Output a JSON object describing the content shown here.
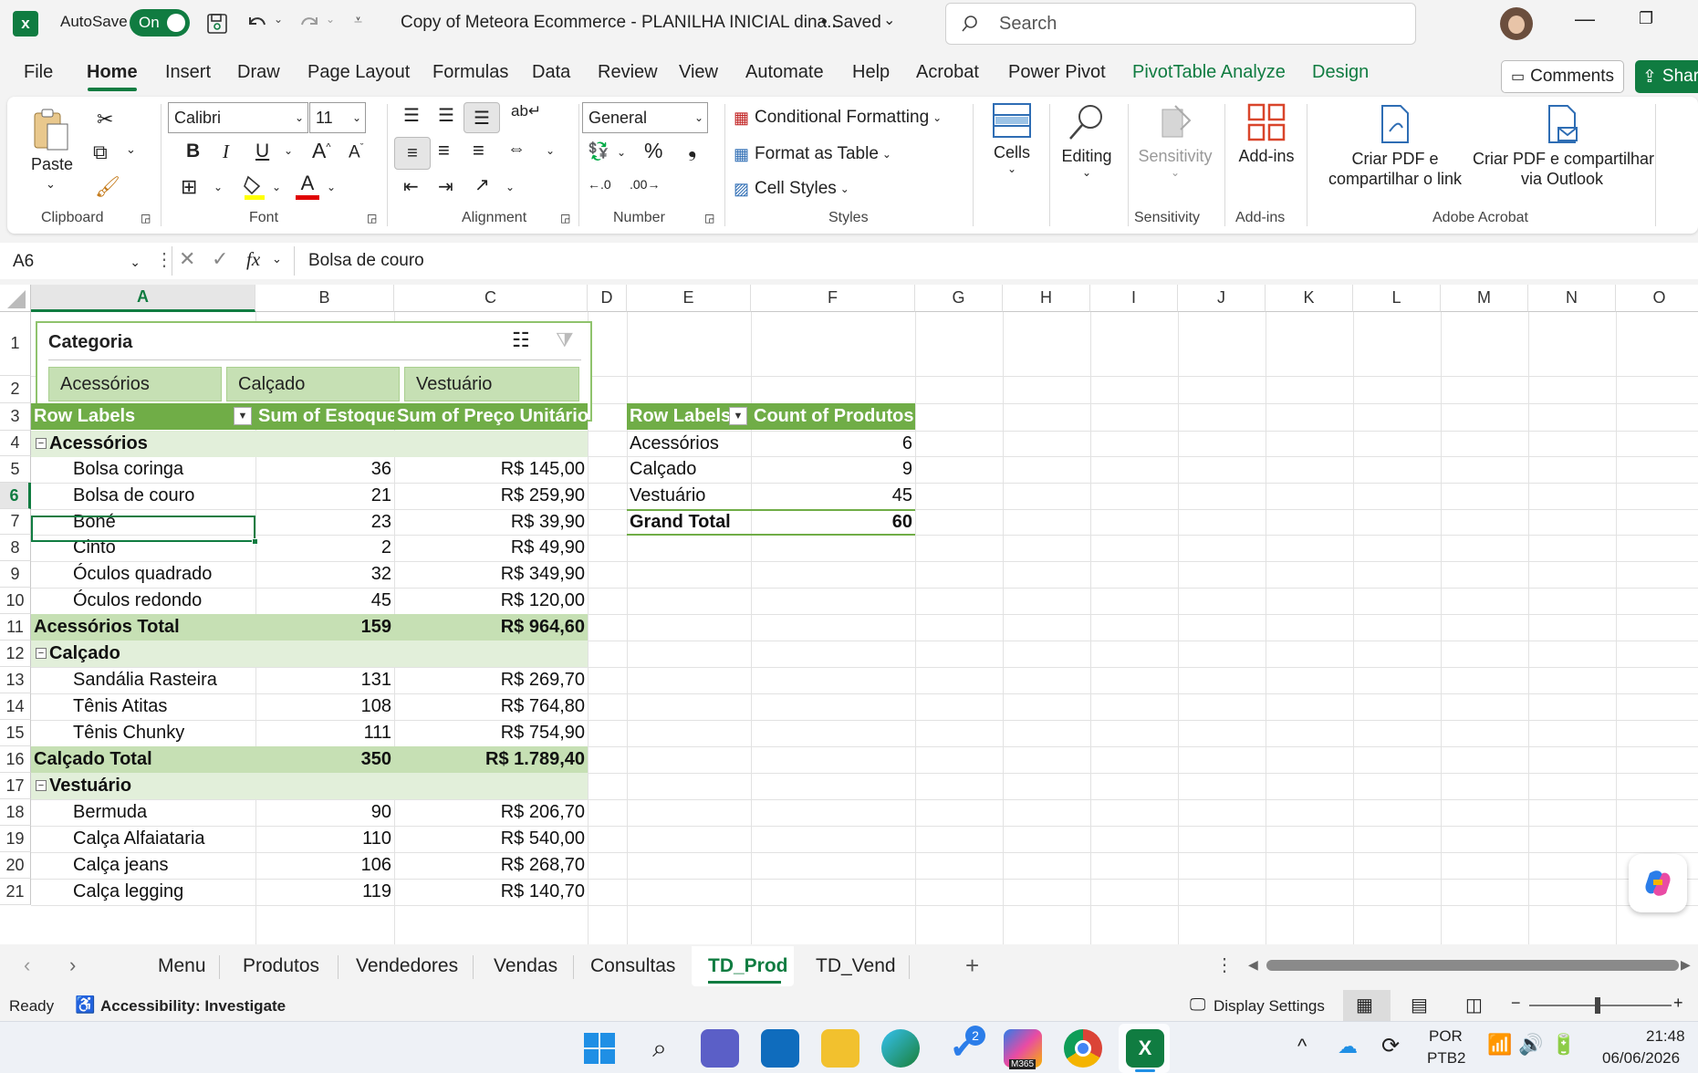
{
  "titlebar": {
    "autosave_label": "AutoSave",
    "autosave_state": "On",
    "doc_title": "Copy of Meteora Ecommerce - PLANILHA INICIAL dina...",
    "saved_state": "• Saved",
    "search_placeholder": "Search"
  },
  "tabs": [
    "File",
    "Home",
    "Insert",
    "Draw",
    "Page Layout",
    "Formulas",
    "Data",
    "Review",
    "View",
    "Automate",
    "Help",
    "Acrobat",
    "Power Pivot",
    "PivotTable Analyze",
    "Design"
  ],
  "active_tab": "Home",
  "comments_label": "Comments",
  "share_label": "Shar",
  "ribbon": {
    "clipboard": {
      "paste": "Paste",
      "label": "Clipboard"
    },
    "font": {
      "name": "Calibri",
      "size": "11",
      "label": "Font"
    },
    "alignment": {
      "label": "Alignment"
    },
    "number": {
      "format": "General",
      "label": "Number"
    },
    "styles": {
      "cond_format": "Conditional Formatting",
      "format_table": "Format as Table",
      "cell_styles": "Cell Styles",
      "label": "Styles"
    },
    "cells": {
      "label": "Cells"
    },
    "editing": {
      "label": "Editing"
    },
    "sensitivity": {
      "btn": "Sensitivity",
      "label": "Sensitivity"
    },
    "addins": {
      "btn": "Add-ins",
      "label": "Add-ins"
    },
    "acrobat": {
      "pdf_link_1": "Criar PDF e",
      "pdf_link_2": "compartilhar o link",
      "pdf_outlook_1": "Criar PDF e compartilhar",
      "pdf_outlook_2": "via Outlook",
      "label": "Adobe Acrobat"
    }
  },
  "formula_bar": {
    "name_box": "A6",
    "fx": "fx",
    "content": "Bolsa de couro"
  },
  "columns": [
    "A",
    "B",
    "C",
    "D",
    "E",
    "F",
    "G",
    "H",
    "I",
    "J",
    "K",
    "L",
    "M",
    "N",
    "O"
  ],
  "rows": [
    "1",
    "2",
    "3",
    "4",
    "5",
    "6",
    "7",
    "8",
    "9",
    "10",
    "11",
    "12",
    "13",
    "14",
    "15",
    "16",
    "17",
    "18",
    "19",
    "20",
    "21"
  ],
  "slicer": {
    "title": "Categoria",
    "items": [
      "Acessórios",
      "Calçado",
      "Vestuário"
    ]
  },
  "pivot1": {
    "headers": [
      "Row Labels",
      "Sum of Estoque",
      "Sum of Preço Unitário"
    ],
    "rows": [
      {
        "kind": "group",
        "label": "Acessórios",
        "a": "",
        "b": ""
      },
      {
        "kind": "item",
        "label": "Bolsa coringa",
        "a": "36",
        "b": "R$ 145,00"
      },
      {
        "kind": "item",
        "label": "Bolsa de couro",
        "a": "21",
        "b": "R$ 259,90"
      },
      {
        "kind": "item",
        "label": "Boné",
        "a": "23",
        "b": "R$ 39,90"
      },
      {
        "kind": "item",
        "label": "Cinto",
        "a": "2",
        "b": "R$ 49,90"
      },
      {
        "kind": "item",
        "label": "Óculos quadrado",
        "a": "32",
        "b": "R$ 349,90"
      },
      {
        "kind": "item",
        "label": "Óculos redondo",
        "a": "45",
        "b": "R$ 120,00"
      },
      {
        "kind": "total",
        "label": "Acessórios Total",
        "a": "159",
        "b": "R$ 964,60"
      },
      {
        "kind": "group",
        "label": "Calçado",
        "a": "",
        "b": ""
      },
      {
        "kind": "item",
        "label": "Sandália Rasteira",
        "a": "131",
        "b": "R$ 269,70"
      },
      {
        "kind": "item",
        "label": "Tênis Atitas",
        "a": "108",
        "b": "R$ 764,80"
      },
      {
        "kind": "item",
        "label": "Tênis Chunky",
        "a": "111",
        "b": "R$ 754,90"
      },
      {
        "kind": "total",
        "label": "Calçado Total",
        "a": "350",
        "b": "R$ 1.789,40"
      },
      {
        "kind": "group",
        "label": "Vestuário",
        "a": "",
        "b": ""
      },
      {
        "kind": "item",
        "label": "Bermuda",
        "a": "90",
        "b": "R$ 206,70"
      },
      {
        "kind": "item",
        "label": "Calça Alfaiataria",
        "a": "110",
        "b": "R$ 540,00"
      },
      {
        "kind": "item",
        "label": "Calça jeans",
        "a": "106",
        "b": "R$ 268,70"
      },
      {
        "kind": "item",
        "label": "Calça legging",
        "a": "119",
        "b": "R$ 140,70"
      }
    ]
  },
  "pivot2": {
    "headers": [
      "Row Labels",
      "Count of Produtos"
    ],
    "rows": [
      {
        "label": "Acessórios",
        "value": "6"
      },
      {
        "label": "Calçado",
        "value": "9"
      },
      {
        "label": "Vestuário",
        "value": "45"
      }
    ],
    "grand_total": {
      "label": "Grand Total",
      "value": "60"
    }
  },
  "sheet_tabs": [
    "Menu",
    "Produtos",
    "Vendedores",
    "Vendas",
    "Consultas",
    "TD_Prod",
    "TD_Vend"
  ],
  "active_sheet": "TD_Prod",
  "status": {
    "ready": "Ready",
    "accessibility": "Accessibility: Investigate",
    "display_settings": "Display Settings"
  },
  "taskbar": {
    "lang1": "POR",
    "lang2": "PTB2",
    "time": "21:48",
    "date": "06/06/2026",
    "badge": "2",
    "m365": "M365"
  },
  "colors": {
    "excel_green": "#107c41",
    "pivot_header": "#70ad47",
    "pivot_total": "#c6e0b4",
    "pivot_sub": "#e2efda"
  }
}
